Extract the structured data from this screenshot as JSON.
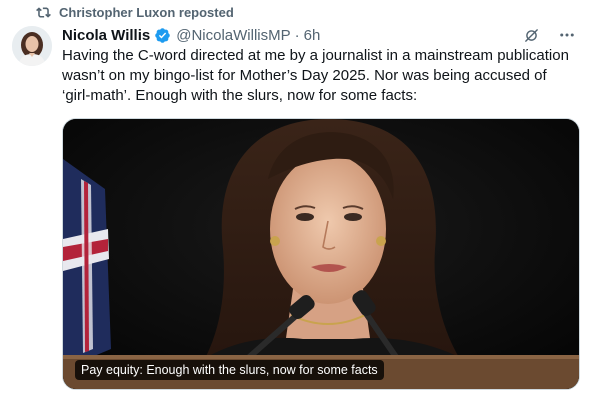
{
  "repost": {
    "label": "Christopher Luxon reposted",
    "icon": "repost-icon"
  },
  "tweet": {
    "author_name": "Nicola Willis",
    "handle": "@NicolaWillisMP",
    "separator": "·",
    "time": "6h",
    "verified_color": "#1d9bf0",
    "text_lines": [
      "Having the C-word directed at me by a journalist in a mainstream publication",
      "wasn’t on my bingo-list for Mother’s Day 2025. Nor was being accused of",
      "‘girl-math’. Enough with the slurs, now for some facts:"
    ]
  },
  "media": {
    "caption": "Pay equity: Enough with the slurs, now for some facts"
  },
  "colors": {
    "text": "#0f1419",
    "secondary": "#536471",
    "border": "#cfd9de"
  }
}
